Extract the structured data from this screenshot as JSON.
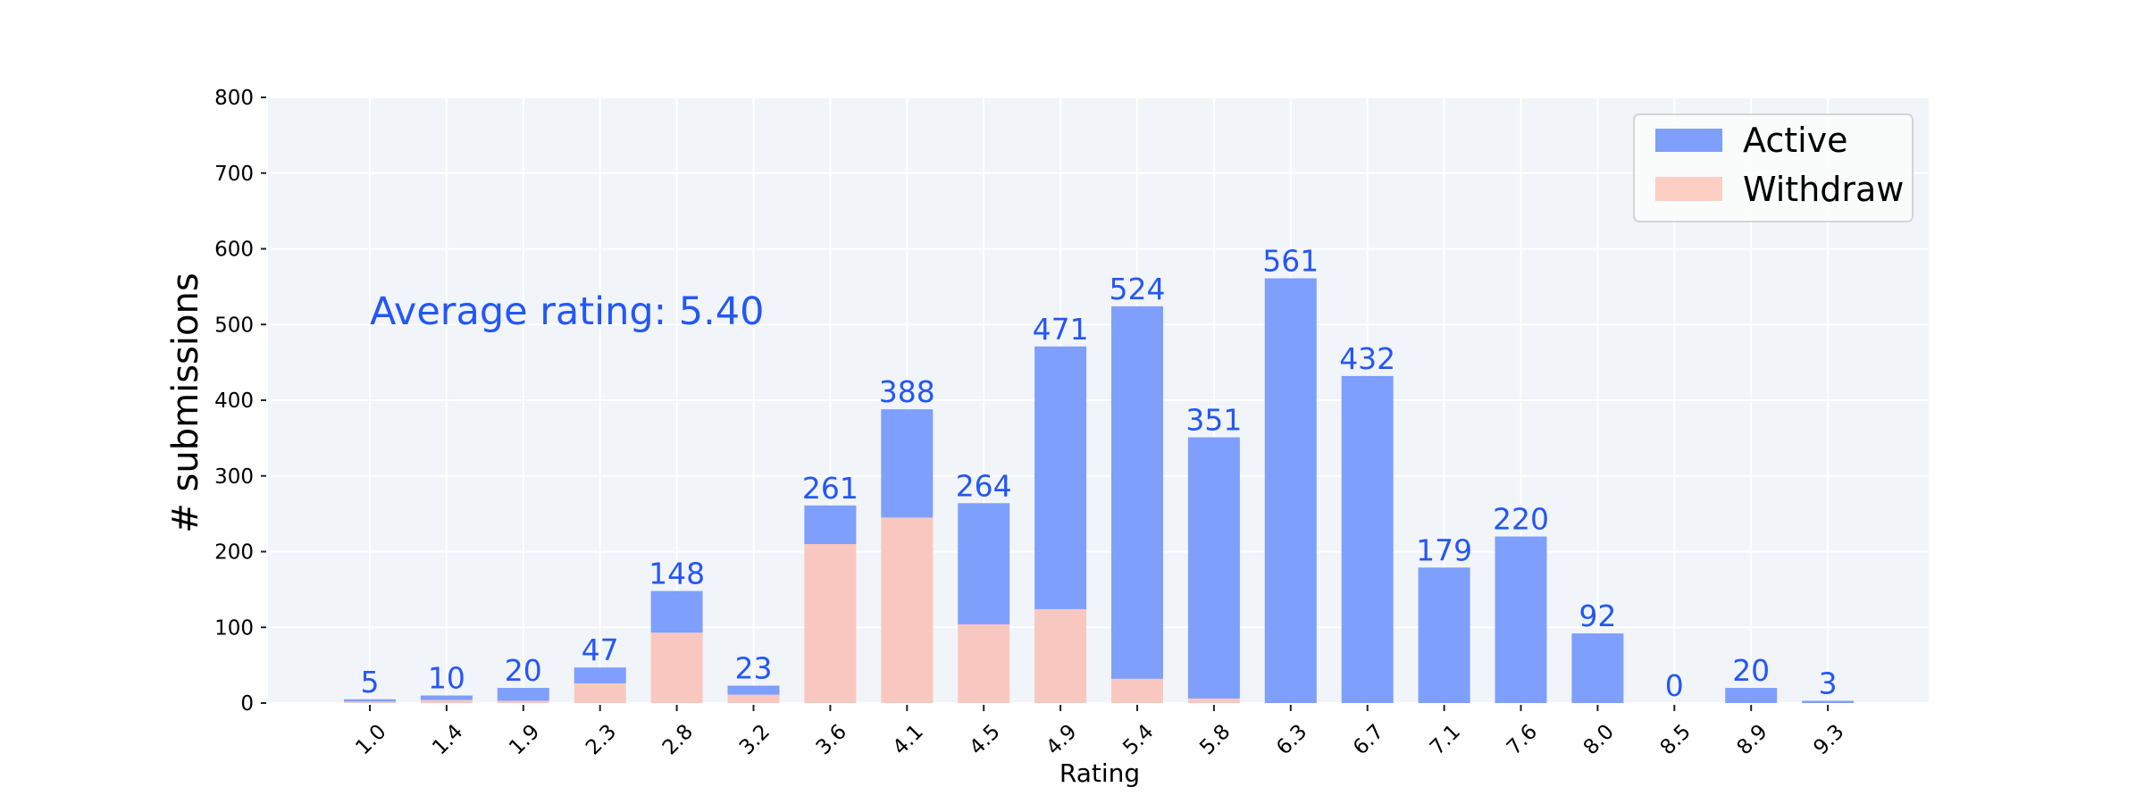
{
  "chart_data": {
    "type": "bar",
    "stacked": true,
    "title": "",
    "xlabel": "Rating",
    "ylabel": "# submissions",
    "ylim": [
      0,
      800
    ],
    "yticks": [
      0,
      100,
      200,
      300,
      400,
      500,
      600,
      700,
      800
    ],
    "grid": true,
    "categories": [
      "1.0",
      "1.4",
      "1.9",
      "2.3",
      "2.8",
      "3.2",
      "3.6",
      "4.1",
      "4.5",
      "4.9",
      "5.4",
      "5.8",
      "6.3",
      "6.7",
      "7.1",
      "7.6",
      "8.0",
      "8.5",
      "8.9",
      "9.3"
    ],
    "totals": [
      5,
      10,
      20,
      47,
      148,
      23,
      261,
      388,
      264,
      471,
      524,
      351,
      561,
      432,
      179,
      220,
      92,
      0,
      20,
      3
    ],
    "series": [
      {
        "name": "Withdraw",
        "color": "#F8C8C0",
        "values": [
          2,
          4,
          3,
          26,
          93,
          11,
          210,
          245,
          104,
          124,
          32,
          6,
          0,
          0,
          0,
          0,
          0,
          0,
          0,
          0
        ]
      },
      {
        "name": "Active",
        "color": "#7F9FFD",
        "values": [
          3,
          6,
          17,
          21,
          55,
          12,
          51,
          143,
          160,
          347,
          492,
          345,
          561,
          432,
          179,
          220,
          92,
          0,
          20,
          3
        ]
      }
    ],
    "legend": {
      "position": "top-right",
      "entries": [
        {
          "label": "Active",
          "color": "#7F9FFD"
        },
        {
          "label": "Withdraw",
          "color": "#FDCFC4"
        }
      ]
    },
    "annotation": "Average rating: 5.40",
    "label_color": "#2457F5",
    "plot_background": "#F1F4F9",
    "grid_color": "#FFFFFF",
    "xtick_rotation_deg": 45
  }
}
